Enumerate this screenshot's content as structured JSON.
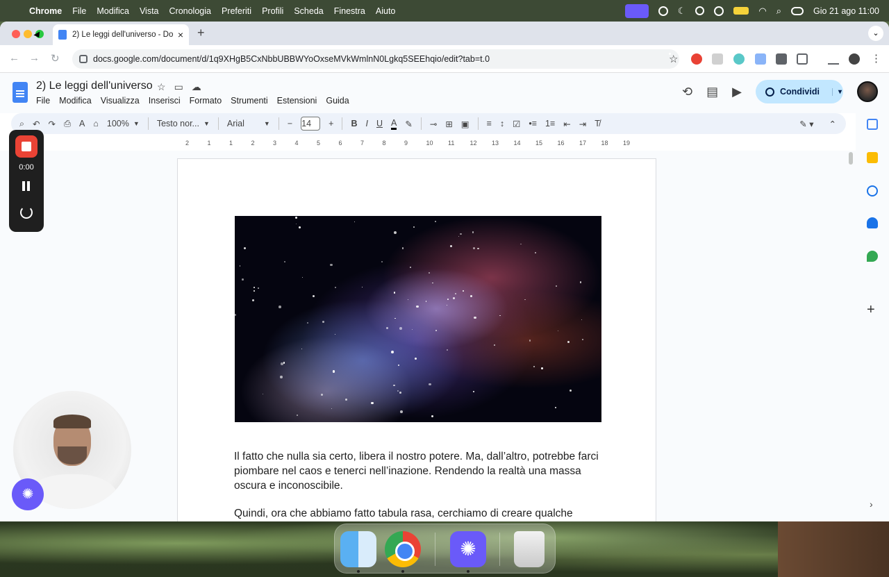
{
  "menubar": {
    "app": "Chrome",
    "items": [
      "File",
      "Modifica",
      "Vista",
      "Cronologia",
      "Preferiti",
      "Profili",
      "Scheda",
      "Finestra",
      "Aiuto"
    ],
    "clock": "Gio 21 ago  11:00"
  },
  "browser": {
    "tab_title": "2) Le leggi dell'universo - Do",
    "url": "docs.google.com/document/d/1q9XHgB5CxNbbUBBWYoOxseMVkWmlnN0Lgkq5SEEhqio/edit?tab=t.0"
  },
  "docs": {
    "title": "2) Le leggi dell'universo",
    "menu": [
      "File",
      "Modifica",
      "Visualizza",
      "Inserisci",
      "Formato",
      "Strumenti",
      "Estensioni",
      "Guida"
    ],
    "share_label": "Condividi",
    "zoom": "100%",
    "style": "Testo nor...",
    "font": "Arial",
    "font_size": "14",
    "ruler_ticks": [
      "2",
      "1",
      "1",
      "2",
      "3",
      "4",
      "5",
      "6",
      "7",
      "8",
      "9",
      "10",
      "11",
      "12",
      "13",
      "14",
      "15",
      "16",
      "17",
      "18",
      "19"
    ],
    "paragraphs": [
      "Il fatto che nulla sia certo, libera il nostro potere. Ma, dall’altro, potrebbe farci piombare nel caos e tenerci nell’inazione. Rendendo la realtà una massa oscura e inconoscibile.",
      "Quindi, ora che abbiamo fatto tabula rasa, cerchiamo di creare qualche nuovo assunto. Distruggiamo le certezze che non ci servono, per costruire"
    ]
  },
  "recorder": {
    "time": "0:00"
  },
  "colors": {
    "accent": "#c2e7ff",
    "record": "#ea4335",
    "assistant": "#6a5af9"
  }
}
